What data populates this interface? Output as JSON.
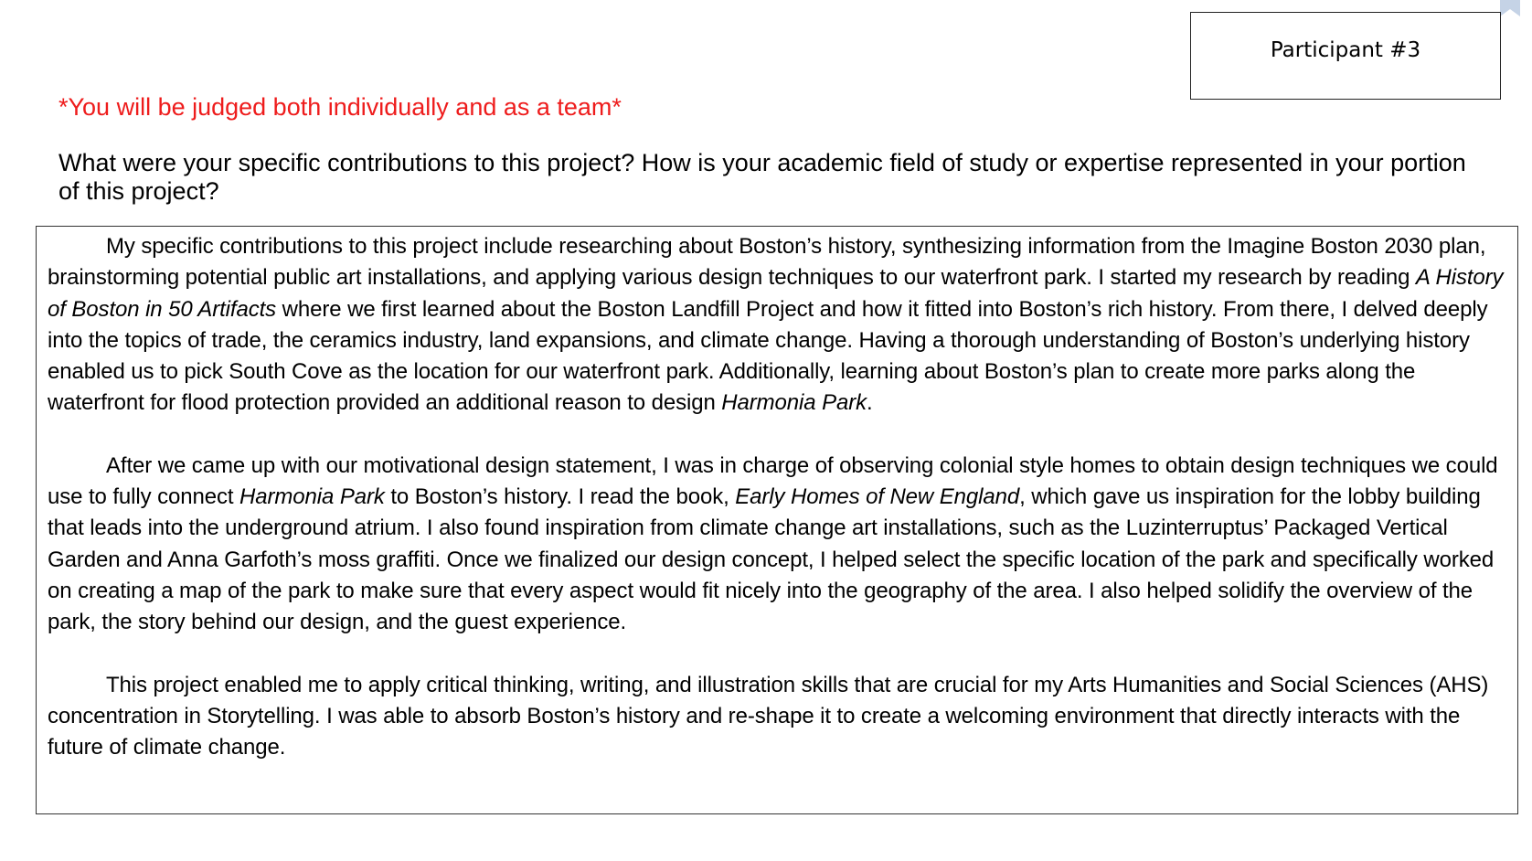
{
  "participant": {
    "label": "Participant #3"
  },
  "notice": {
    "text": "*You will be judged both individually and as a team*",
    "color": "#ee1c1c"
  },
  "question": {
    "text": "What were your specific contributions to this project? How is your academic field of study or expertise represented in your portion of this project?"
  },
  "answer": {
    "p1": {
      "s1": "My specific contributions to this project include researching about Boston’s history, synthesizing information from the Imagine Boston 2030 plan, brainstorming potential public art installations, and applying various design techniques to our waterfront park. I started my research by reading ",
      "book1": "A History of Boston in 50 Artifacts",
      "s2": " where we first learned about the Boston Landfill Project and how it fitted into Boston’s rich history. From there, I delved deeply into the topics of trade, the ceramics industry, land expansions, and climate change. Having a thorough understanding of Boston’s underlying history enabled us to pick South Cove as the location for our waterfront park. Additionally, learning about Boston’s plan to create more parks along the waterfront for flood protection provided an additional reason to design ",
      "park": "Harmonia Park",
      "s3": "."
    },
    "p2": {
      "s1": "After we came up with our motivational design statement, I was in charge of observing colonial style homes to obtain design techniques we could use to fully connect ",
      "park": "Harmonia Park",
      "s2": " to Boston’s history. I read the book, ",
      "book2": "Early Homes of New England",
      "s3": ", which gave us inspiration for the lobby building that leads into the underground atrium. I also found inspiration from climate change art installations, such as the Luzinterruptus’ Packaged Vertical Garden and Anna Garfoth’s moss graffiti. Once we finalized our design concept, I helped select the specific location of the park and specifically worked on creating a map of the park to make sure that every aspect would fit nicely into the geography of the area. I also helped solidify the overview of the park, the story behind our design, and the guest experience."
    },
    "p3": {
      "text": "This project enabled me to apply critical thinking, writing, and illustration skills that are crucial for my Arts Humanities and Social Sciences (AHS) concentration in Storytelling. I was able to absorb Boston’s history and re-shape it to create a welcoming environment that directly interacts with the future of climate change."
    }
  },
  "icons": {
    "corner": "bookmark-icon"
  }
}
